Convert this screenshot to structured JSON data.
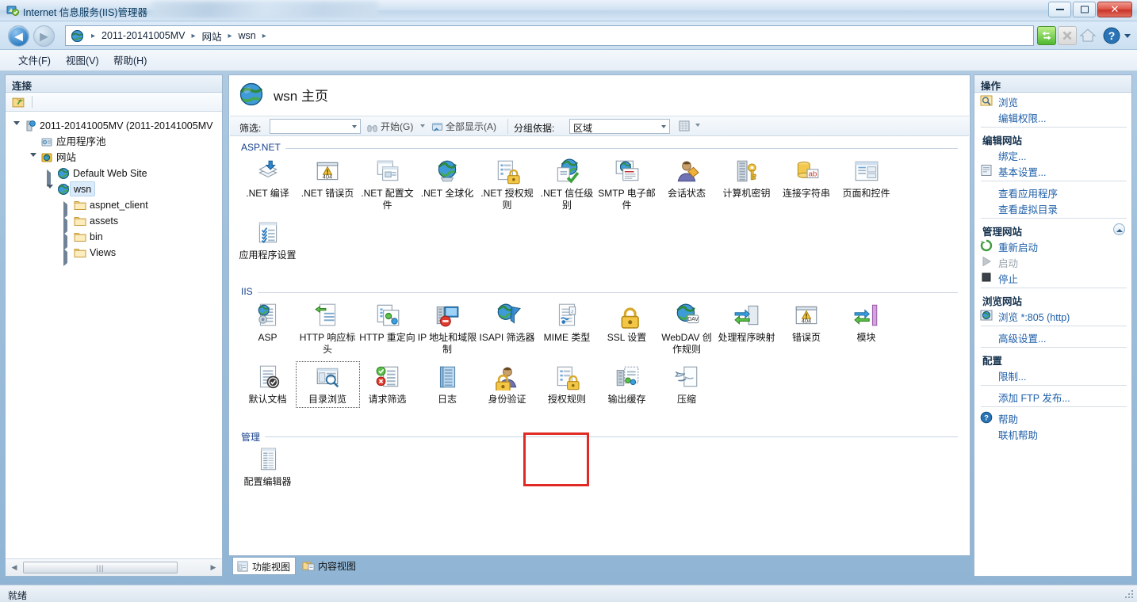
{
  "window": {
    "title": "Internet 信息服务(IIS)管理器",
    "icon": "iis-app-icon",
    "minimize_label": "最小化",
    "maximize_label": "最大化",
    "close_label": "关闭"
  },
  "address_bar": {
    "back_label": "后退",
    "forward_label": "前进",
    "crumbs": [
      "2011-20141005MV",
      "网站",
      "wsn"
    ],
    "separator": "▸",
    "tools": [
      {
        "name": "refresh-icon",
        "label": "刷新"
      },
      {
        "name": "stop-icon",
        "label": "停止"
      },
      {
        "name": "home-icon",
        "label": "主页"
      },
      {
        "name": "help-icon",
        "label": "帮助"
      }
    ]
  },
  "menubar": {
    "items": [
      "文件(F)",
      "视图(V)",
      "帮助(H)"
    ]
  },
  "connections": {
    "header": "连接",
    "tree": [
      {
        "label": "2011-20141005MV (2011-20141005MV",
        "icon": "server-icon",
        "indent": 0,
        "state": "open",
        "selected": false
      },
      {
        "label": "应用程序池",
        "icon": "app-pool-icon",
        "indent": 1,
        "state": "leaf",
        "selected": false
      },
      {
        "label": "网站",
        "icon": "sites-icon",
        "indent": 1,
        "state": "open",
        "selected": false
      },
      {
        "label": "Default Web Site",
        "icon": "site-icon",
        "indent": 2,
        "state": "closed",
        "selected": false
      },
      {
        "label": "wsn",
        "icon": "site-icon",
        "indent": 2,
        "state": "open",
        "selected": true
      },
      {
        "label": "aspnet_client",
        "icon": "folder-icon",
        "indent": 3,
        "state": "closed",
        "selected": false
      },
      {
        "label": "assets",
        "icon": "folder-icon",
        "indent": 3,
        "state": "closed",
        "selected": false
      },
      {
        "label": "bin",
        "icon": "folder-icon",
        "indent": 3,
        "state": "closed",
        "selected": false
      },
      {
        "label": "Views",
        "icon": "folder-icon",
        "indent": 3,
        "state": "closed",
        "selected": false
      }
    ]
  },
  "main": {
    "title": "wsn 主页",
    "filter": {
      "filter_label": "筛选:",
      "filter_value": "",
      "go_label": "开始(G)",
      "show_all_label": "全部显示(A)",
      "group_by_label": "分组依据:",
      "group_by_value": "区域"
    },
    "sections": [
      {
        "name": "ASP.NET",
        "tiles": [
          {
            "label": ".NET 编译",
            "icon": "net-compilation-icon"
          },
          {
            "label": ".NET 错误页",
            "icon": "net-error-pages-icon"
          },
          {
            "label": ".NET 配置文件",
            "icon": "net-profile-icon"
          },
          {
            "label": ".NET 全球化",
            "icon": "net-globalization-icon"
          },
          {
            "label": ".NET 授权规则",
            "icon": "net-authorization-icon"
          },
          {
            "label": ".NET 信任级别",
            "icon": "net-trust-levels-icon"
          },
          {
            "label": "SMTP 电子邮件",
            "icon": "smtp-email-icon"
          },
          {
            "label": "会话状态",
            "icon": "session-state-icon"
          },
          {
            "label": "计算机密钥",
            "icon": "machine-key-icon"
          },
          {
            "label": "连接字符串",
            "icon": "connection-strings-icon"
          },
          {
            "label": "页面和控件",
            "icon": "pages-controls-icon"
          },
          {
            "label": "应用程序设置",
            "icon": "app-settings-icon"
          }
        ]
      },
      {
        "name": "IIS",
        "tiles": [
          {
            "label": "ASP",
            "icon": "asp-icon"
          },
          {
            "label": "HTTP 响应标头",
            "icon": "http-response-headers-icon"
          },
          {
            "label": "HTTP 重定向",
            "icon": "http-redirect-icon"
          },
          {
            "label": "IP 地址和域限制",
            "icon": "ip-domain-restrictions-icon"
          },
          {
            "label": "ISAPI 筛选器",
            "icon": "isapi-filters-icon"
          },
          {
            "label": "MIME 类型",
            "icon": "mime-types-icon"
          },
          {
            "label": "SSL 设置",
            "icon": "ssl-settings-icon"
          },
          {
            "label": "WebDAV 创作规则",
            "icon": "webdav-icon"
          },
          {
            "label": "处理程序映射",
            "icon": "handler-mappings-icon"
          },
          {
            "label": "错误页",
            "icon": "error-pages-icon"
          },
          {
            "label": "模块",
            "icon": "modules-icon"
          },
          {
            "label": "默认文档",
            "icon": "default-document-icon"
          },
          {
            "label": "目录浏览",
            "icon": "directory-browsing-icon",
            "selected": true
          },
          {
            "label": "请求筛选",
            "icon": "request-filtering-icon"
          },
          {
            "label": "日志",
            "icon": "logging-icon"
          },
          {
            "label": "身份验证",
            "icon": "authentication-icon"
          },
          {
            "label": "授权规则",
            "icon": "authorization-rules-icon"
          },
          {
            "label": "输出缓存",
            "icon": "output-caching-icon"
          },
          {
            "label": "压缩",
            "icon": "compression-icon"
          }
        ]
      },
      {
        "name": "管理",
        "tiles": [
          {
            "label": "配置编辑器",
            "icon": "configuration-editor-icon"
          }
        ]
      }
    ],
    "view_tabs": [
      {
        "label": "功能视图",
        "icon": "features-view-icon",
        "active": true
      },
      {
        "label": "内容视图",
        "icon": "content-view-icon",
        "active": false
      }
    ]
  },
  "actions": {
    "header": "操作",
    "groups": [
      {
        "title": null,
        "items": [
          {
            "label": "浏览",
            "icon": "browse-icon",
            "disabled": false
          },
          {
            "label": "编辑权限...",
            "icon": null,
            "disabled": false
          }
        ]
      },
      {
        "title": "编辑网站",
        "collapsible": false,
        "items": [
          {
            "label": "绑定...",
            "icon": null,
            "disabled": false
          },
          {
            "label": "基本设置...",
            "icon": "basic-settings-icon",
            "disabled": false
          }
        ]
      },
      {
        "title": null,
        "items": [
          {
            "label": "查看应用程序",
            "icon": null,
            "disabled": false
          },
          {
            "label": "查看虚拟目录",
            "icon": null,
            "disabled": false
          }
        ]
      },
      {
        "title": "管理网站",
        "collapsible": true,
        "items": [
          {
            "label": "重新启动",
            "icon": "restart-icon",
            "disabled": false
          },
          {
            "label": "启动",
            "icon": "start-icon",
            "disabled": true
          },
          {
            "label": "停止",
            "icon": "stop-square-icon",
            "disabled": false
          }
        ]
      },
      {
        "title": "浏览网站",
        "collapsible": false,
        "items": [
          {
            "label": "浏览 *:805 (http)",
            "icon": "browse-site-icon",
            "disabled": false
          }
        ]
      },
      {
        "title": null,
        "items": [
          {
            "label": "高级设置...",
            "icon": null,
            "disabled": false
          }
        ]
      },
      {
        "title": "配置",
        "collapsible": false,
        "items": [
          {
            "label": "限制...",
            "icon": null,
            "disabled": false
          }
        ]
      },
      {
        "title": null,
        "items": [
          {
            "label": "添加 FTP 发布...",
            "icon": null,
            "disabled": false
          }
        ]
      },
      {
        "title": null,
        "items": [
          {
            "label": "帮助",
            "icon": "help-circle-icon",
            "disabled": false
          },
          {
            "label": "联机帮助",
            "icon": null,
            "disabled": false
          }
        ]
      }
    ]
  },
  "statusbar": {
    "text": "就绪"
  },
  "colors": {
    "accent_blue": "#1f5fa8",
    "section_label": "#16418c",
    "highlight_red": "#e02a23",
    "close_red": "#c9352a"
  }
}
